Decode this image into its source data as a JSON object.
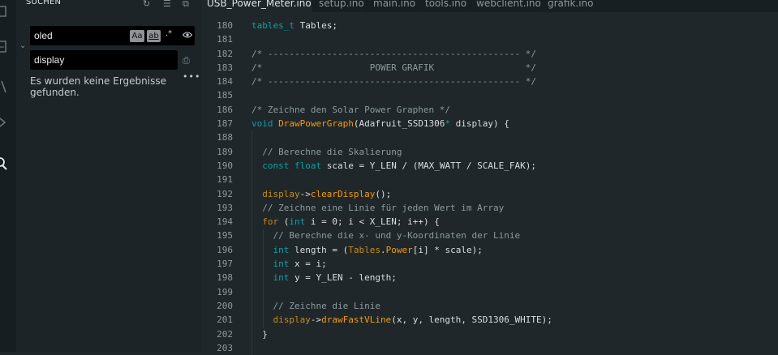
{
  "sidebar": {
    "title": "SUCHEN",
    "search": {
      "value": "oled",
      "match_case_label": "Aa",
      "whole_word_label": "ab",
      "regex_label": ".*"
    },
    "replace": {
      "value": "display"
    },
    "no_results": "Es wurden keine Ergebnisse gefunden."
  },
  "tabs": [
    {
      "label": "USB_Power_Meter.ino",
      "active": true
    },
    {
      "label": "setup.ino"
    },
    {
      "label": "main.ino"
    },
    {
      "label": "tools.ino"
    },
    {
      "label": "webclient.ino"
    },
    {
      "label": "grafik.ino"
    }
  ],
  "code_lines": [
    {
      "n": "180",
      "tokens": [
        [
          "t-type",
          "tables_t"
        ],
        [
          "t-pl",
          " Tables;"
        ]
      ]
    },
    {
      "n": "181",
      "tokens": []
    },
    {
      "n": "182",
      "tokens": [
        [
          "t-cm",
          "/* ----------------------------------------------- */"
        ]
      ]
    },
    {
      "n": "183",
      "tokens": [
        [
          "t-cm",
          "/*                    POWER GRAFIK                 */"
        ]
      ]
    },
    {
      "n": "184",
      "tokens": [
        [
          "t-cm",
          "/* ----------------------------------------------- */"
        ]
      ]
    },
    {
      "n": "185",
      "tokens": []
    },
    {
      "n": "186",
      "tokens": [
        [
          "t-cm",
          "/* Zeichne den Solar Power Graphen */"
        ]
      ]
    },
    {
      "n": "187",
      "tokens": [
        [
          "t-type",
          "void"
        ],
        [
          "t-pl",
          " "
        ],
        [
          "t-fn",
          "DrawPowerGraph"
        ],
        [
          "t-pl",
          "(Adafruit_SSD1306"
        ],
        [
          "t-type",
          "*"
        ],
        [
          "t-pl",
          " display) {"
        ]
      ]
    },
    {
      "n": "188",
      "tokens": []
    },
    {
      "n": "189",
      "tokens": [
        [
          "t-pl",
          "  "
        ],
        [
          "t-cm",
          "// Berechne die Skalierung"
        ]
      ]
    },
    {
      "n": "190",
      "tokens": [
        [
          "t-pl",
          "  "
        ],
        [
          "t-type",
          "const"
        ],
        [
          "t-pl",
          " "
        ],
        [
          "t-type",
          "float"
        ],
        [
          "t-pl",
          " scale = Y_LEN / (MAX_WATT / SCALE_FAK);"
        ]
      ]
    },
    {
      "n": "191",
      "tokens": []
    },
    {
      "n": "192",
      "tokens": [
        [
          "t-pl",
          "  "
        ],
        [
          "t-kw",
          "display"
        ],
        [
          "t-pl",
          "->"
        ],
        [
          "t-fn",
          "clearDisplay"
        ],
        [
          "t-pl",
          "();"
        ]
      ]
    },
    {
      "n": "193",
      "tokens": [
        [
          "t-pl",
          "  "
        ],
        [
          "t-cm",
          "// Zeichne eine Linie für jeden Wert im Array"
        ]
      ]
    },
    {
      "n": "194",
      "tokens": [
        [
          "t-pl",
          "  "
        ],
        [
          "t-kw",
          "for"
        ],
        [
          "t-pl",
          " ("
        ],
        [
          "t-type",
          "int"
        ],
        [
          "t-pl",
          " i = 0; i < X_LEN; i++) {"
        ]
      ]
    },
    {
      "n": "195",
      "tokens": [
        [
          "t-pl",
          "    "
        ],
        [
          "t-cm",
          "// Berechne die x- und y-Koordinaten der Linie"
        ]
      ]
    },
    {
      "n": "196",
      "tokens": [
        [
          "t-pl",
          "    "
        ],
        [
          "t-type",
          "int"
        ],
        [
          "t-pl",
          " length = ("
        ],
        [
          "t-kw",
          "Tables"
        ],
        [
          "t-pl",
          "."
        ],
        [
          "t-fn",
          "Power"
        ],
        [
          "t-pl",
          "[i] * scale);"
        ]
      ]
    },
    {
      "n": "197",
      "tokens": [
        [
          "t-pl",
          "    "
        ],
        [
          "t-type",
          "int"
        ],
        [
          "t-pl",
          " x = i;"
        ]
      ]
    },
    {
      "n": "198",
      "tokens": [
        [
          "t-pl",
          "    "
        ],
        [
          "t-type",
          "int"
        ],
        [
          "t-pl",
          " y = Y_LEN - length;"
        ]
      ]
    },
    {
      "n": "199",
      "tokens": []
    },
    {
      "n": "200",
      "tokens": [
        [
          "t-pl",
          "    "
        ],
        [
          "t-cm",
          "// Zeichne die Linie"
        ]
      ]
    },
    {
      "n": "201",
      "tokens": [
        [
          "t-pl",
          "    "
        ],
        [
          "t-kw",
          "display"
        ],
        [
          "t-pl",
          "->"
        ],
        [
          "t-fn",
          "drawFastVLine"
        ],
        [
          "t-pl",
          "(x, y, length, SSD1306_WHITE);"
        ]
      ]
    },
    {
      "n": "202",
      "tokens": [
        [
          "t-pl",
          "  }"
        ]
      ]
    },
    {
      "n": "203",
      "tokens": []
    }
  ],
  "icons": [
    "explorer-icon",
    "files-icon",
    "source-control-icon",
    "run-icon",
    "search-icon",
    "refresh-icon",
    "clear-results-icon",
    "collapse-icon",
    "chevron-down-icon",
    "eye-icon",
    "replace-all-icon",
    "ellipsis-icon"
  ],
  "colors": {
    "background": "#1f272a",
    "sidebar": "#1c2427",
    "type": "#0ca1a6",
    "keyword": "#c78a1f",
    "function": "#f39c12",
    "comment": "#8c9a9e"
  }
}
